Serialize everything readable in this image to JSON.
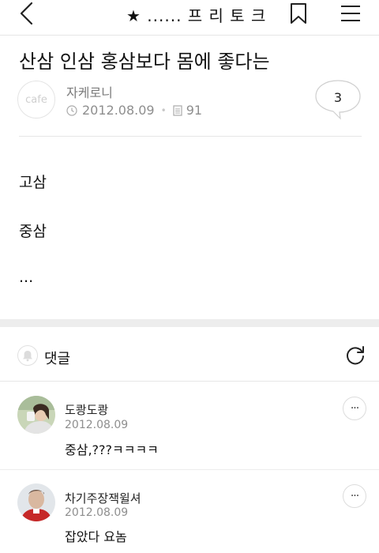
{
  "topbar": {
    "title": "★ ...... 프 리 토 크",
    "icons": {
      "back": "chevron-left-icon",
      "bookmark": "bookmark-icon",
      "menu": "hamburger-menu-icon"
    }
  },
  "post": {
    "title": "산삼 인삼 홍삼보다 몸에 좋다는",
    "avatar_text": "cafe",
    "author": "자케로니",
    "date": "2012.08.09",
    "views": "91",
    "comment_count": "3",
    "body": [
      "고삼",
      "중삼",
      "..."
    ]
  },
  "comments_section": {
    "label": "댓글",
    "icons": {
      "bell": "bell-icon",
      "refresh": "refresh-icon"
    }
  },
  "comments": [
    {
      "author": "도쾅도쾅",
      "date": "2012.08.09",
      "text": "중삼,???ㅋㅋㅋㅋ",
      "more": "···"
    },
    {
      "author": "차기주장잭윌셔",
      "date": "2012.08.09",
      "text": "잡았다 요놈",
      "more": "···"
    }
  ],
  "colors": {
    "divider": "#e6e6e6",
    "band": "#ededed",
    "meta": "#8e8e8e"
  }
}
